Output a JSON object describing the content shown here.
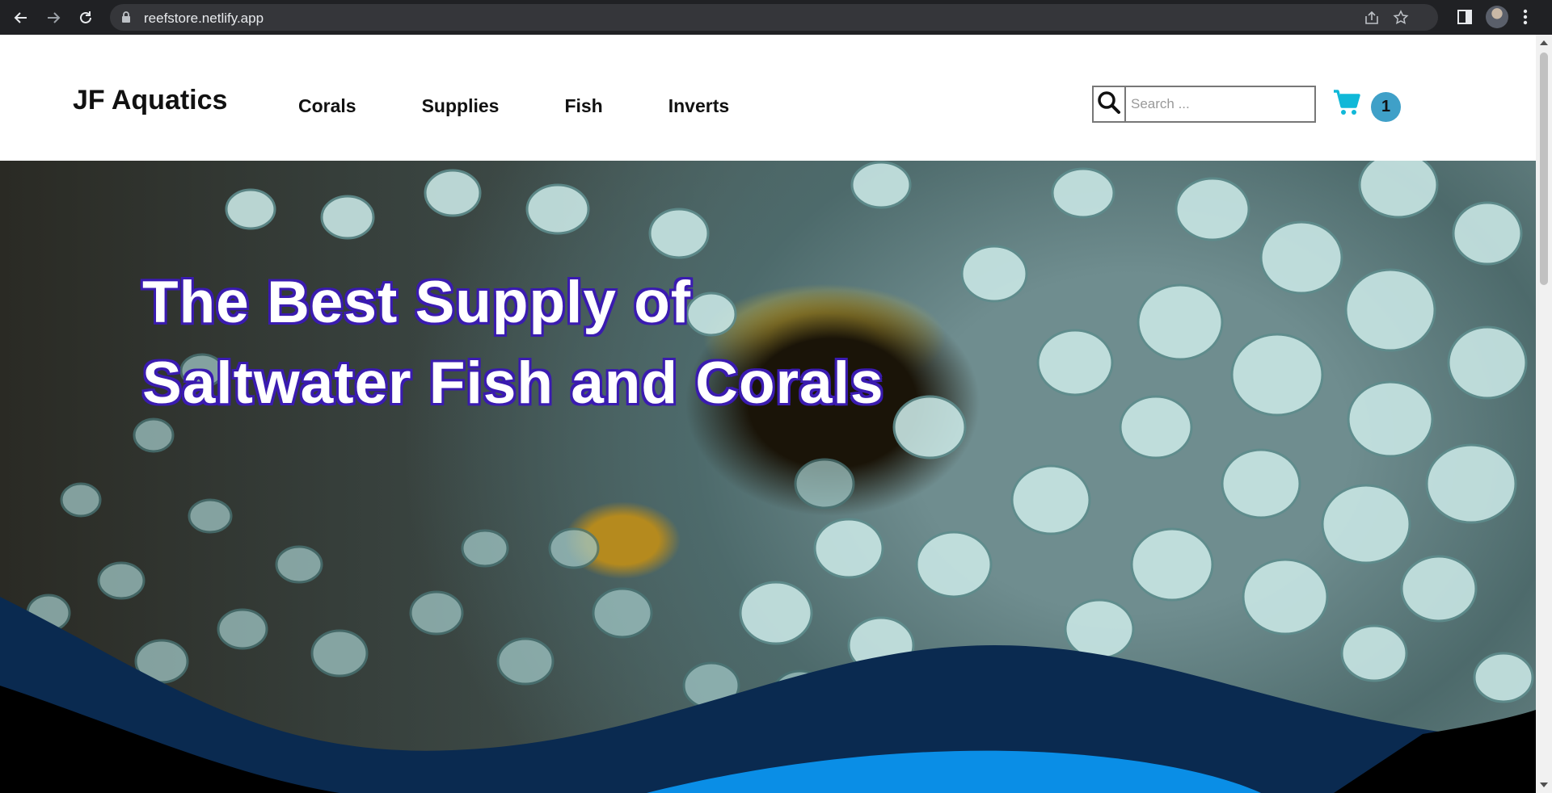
{
  "browser": {
    "url": "reefstore.netlify.app"
  },
  "site": {
    "logo": "JF Aquatics",
    "nav": [
      {
        "label": "Corals"
      },
      {
        "label": "Supplies"
      },
      {
        "label": "Fish"
      },
      {
        "label": "Inverts"
      }
    ],
    "search": {
      "placeholder": "Search ...",
      "value": ""
    },
    "cart": {
      "count": "1"
    }
  },
  "hero": {
    "title_line1": "The Best Supply of",
    "title_line2": "Saltwater Fish and Corals"
  },
  "colors": {
    "cart_icon": "#10b8d8",
    "cart_badge": "#3fa0c8",
    "wave_dark": "#0a2a50",
    "wave_bright": "#0a8ee6",
    "title_outline": "#3a1bb0"
  }
}
